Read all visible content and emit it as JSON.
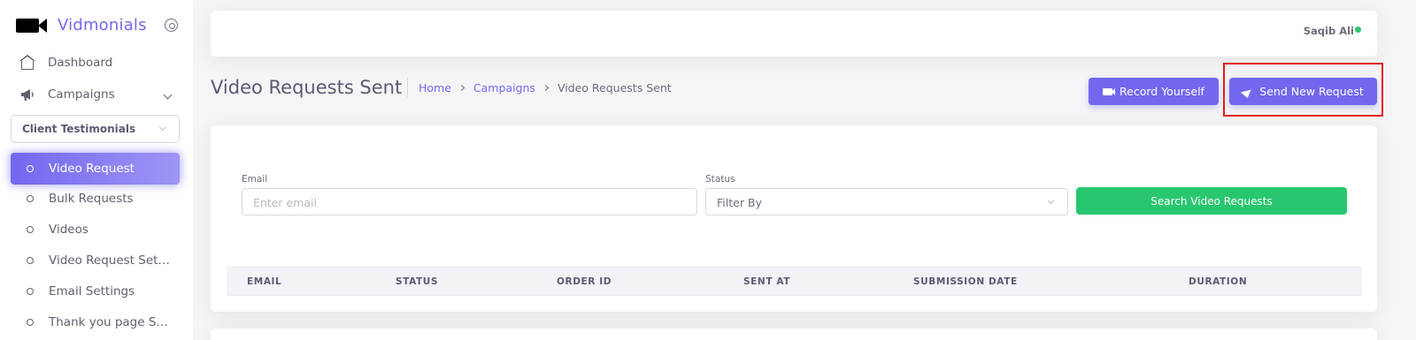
{
  "brand": {
    "name": "Vidmonials"
  },
  "sidebar": {
    "nav": [
      {
        "label": "Dashboard",
        "icon": "home-icon"
      },
      {
        "label": "Campaigns",
        "icon": "megaphone-icon"
      }
    ],
    "campaign_select": {
      "value": "Client Testimonials"
    },
    "sub_items": [
      {
        "label": "Video Request",
        "active": true
      },
      {
        "label": "Bulk Requests"
      },
      {
        "label": "Videos"
      },
      {
        "label": "Video Request Setti..."
      },
      {
        "label": "Email Settings"
      },
      {
        "label": "Thank you page Set..."
      }
    ]
  },
  "topbar": {
    "user_name": "Saqib Ali",
    "status_color": "#28c76f"
  },
  "page": {
    "title": "Video Requests Sent",
    "breadcrumb": [
      "Home",
      "Campaigns",
      "Video Requests Sent"
    ],
    "record_button": "Record Yourself",
    "send_button": "Send New Request"
  },
  "filters": {
    "email_label": "Email",
    "email_placeholder": "Enter email",
    "status_label": "Status",
    "status_value": "Filter By",
    "search_button": "Search Video Requests"
  },
  "table": {
    "columns": [
      "EMAIL",
      "STATUS",
      "ORDER ID",
      "SENT AT",
      "SUBMISSION DATE",
      "DURATION"
    ]
  },
  "colors": {
    "primary": "#7367f0",
    "success": "#28c76f",
    "highlight": "#e51b1b"
  }
}
